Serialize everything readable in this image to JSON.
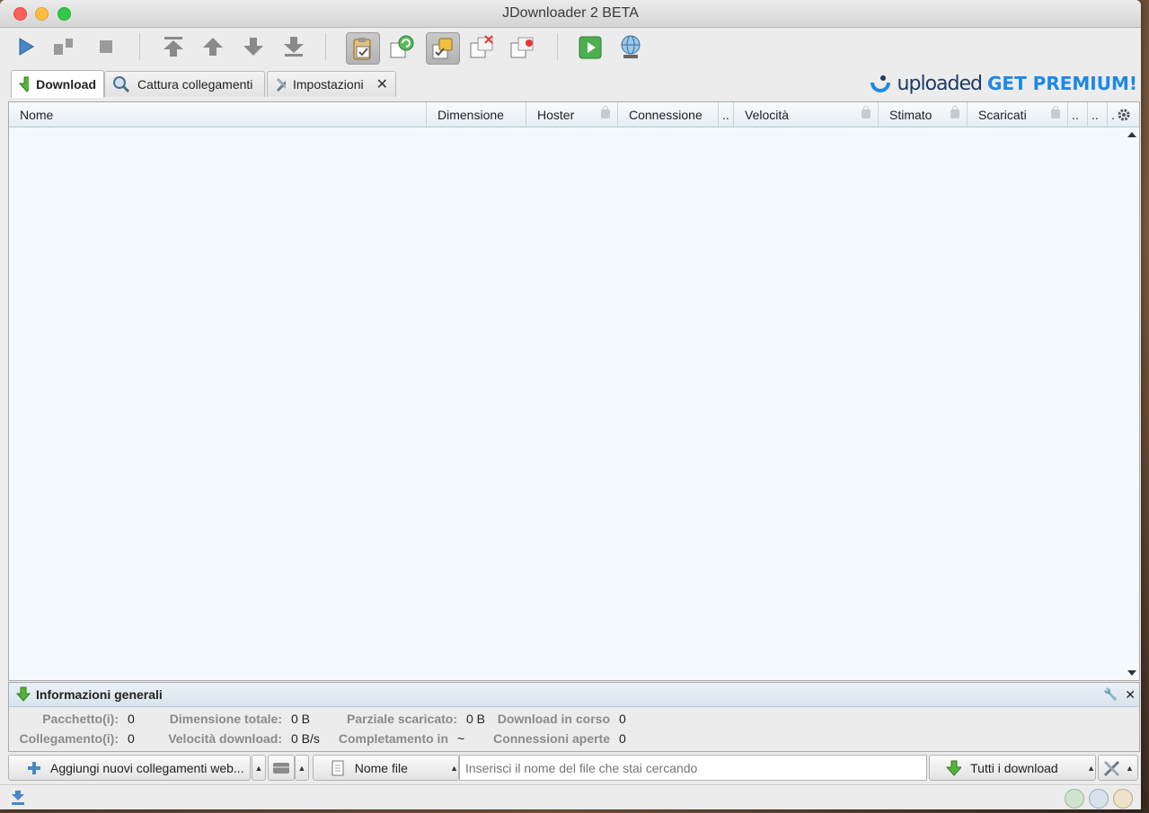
{
  "window": {
    "title": "JDownloader 2 BETA"
  },
  "toolbar": {
    "items": [
      {
        "name": "start-downloads",
        "icon": "play-icon"
      },
      {
        "name": "pause-downloads",
        "icon": "pause-icon"
      },
      {
        "name": "stop-downloads",
        "icon": "stop-icon"
      },
      {
        "name": "move-top",
        "icon": "arrow-top-icon"
      },
      {
        "name": "move-up",
        "icon": "arrow-up-icon"
      },
      {
        "name": "move-down",
        "icon": "arrow-down-icon"
      },
      {
        "name": "move-bottom",
        "icon": "arrow-bottom-icon"
      },
      {
        "name": "clipboard-observer",
        "icon": "clipboard-icon",
        "active": true
      },
      {
        "name": "auto-reconnect",
        "icon": "reconnect-icon",
        "active": false
      },
      {
        "name": "premium-toggle",
        "icon": "premium-icon",
        "active": true
      },
      {
        "name": "silent-mode",
        "icon": "silent-icon"
      },
      {
        "name": "shutdown",
        "icon": "shutdown-icon"
      },
      {
        "name": "update",
        "icon": "update-icon"
      },
      {
        "name": "reconnect-now",
        "icon": "globe-icon"
      }
    ]
  },
  "tabs": [
    {
      "label": "Download",
      "icon": "download-arrow-icon",
      "selected": true
    },
    {
      "label": "Cattura collegamenti",
      "icon": "linkgrabber-icon",
      "selected": false
    },
    {
      "label": "Impostazioni",
      "icon": "settings-tools-icon",
      "selected": false,
      "closable": true
    }
  ],
  "banner": {
    "brand": "uploaded",
    "cta": "GET PREMIUM!",
    "colors": {
      "brand": "#1d3b66",
      "cta": "#1e88e5"
    }
  },
  "table": {
    "columns": [
      "Nome",
      "Dimensione",
      "Hoster",
      "Connessione",
      "..",
      "Velocità",
      "Stimato",
      "Scaricati",
      "..",
      "..",
      "."
    ],
    "rows": []
  },
  "info": {
    "title": "Informazioni generali",
    "row1": [
      {
        "label": "Pacchetto(i):",
        "value": "0"
      },
      {
        "label": "Dimensione totale:",
        "value": "0 B"
      },
      {
        "label": "Parziale scaricato:",
        "value": "0 B"
      },
      {
        "label": "Download in corso",
        "value": "0"
      }
    ],
    "row2": [
      {
        "label": "Collegamento(i):",
        "value": "0"
      },
      {
        "label": "Velocità download:",
        "value": "0 B/s"
      },
      {
        "label": "Completamento in",
        "value": "~"
      },
      {
        "label": "Connessioni aperte",
        "value": "0"
      }
    ]
  },
  "bottom": {
    "add_links": "Aggiungi nuovi collegamenti web...",
    "search_field": "Nome file",
    "search_placeholder": "Inserisci il nome del file che stai cercando",
    "filter": "Tutti i download"
  }
}
